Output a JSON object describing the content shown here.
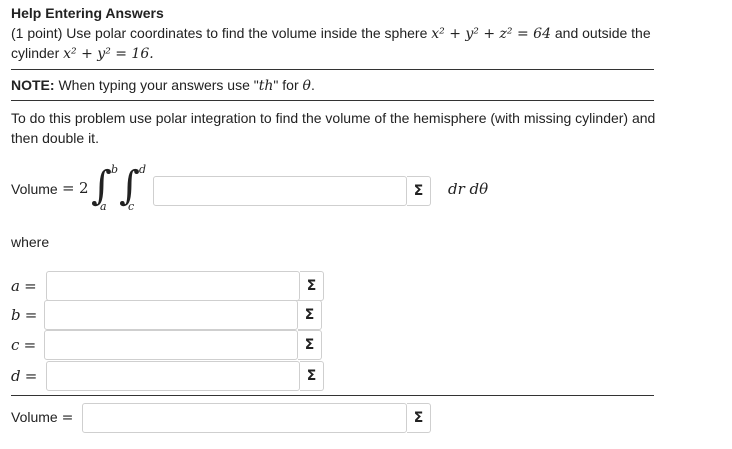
{
  "help_link": "Help Entering Answers",
  "problem": {
    "line1_text": "(1 point) Use polar coordinates to find the volume inside the sphere",
    "sphere_eq": "x² + y² + z² = 64",
    "line1_end": "and outside the",
    "line2_text": "cylinder",
    "cylinder_eq": "x² + y² = 16."
  },
  "note": {
    "label": "NOTE:",
    "text": "When typing your answers use \"",
    "th": "th",
    "mid": "\" for",
    "theta": "θ",
    "end": "."
  },
  "instructions": {
    "line1": "To do this problem use polar integration to find the volume of the hemisphere (with missing cylinder) and",
    "line2": "then double it."
  },
  "integral": {
    "volume_label": "Volume",
    "equals": "=",
    "coefficient": "2",
    "outer_lower": "a",
    "outer_upper": "b",
    "inner_lower": "c",
    "inner_upper": "d",
    "differentials": "dr dθ",
    "integrand_value": ""
  },
  "where_label": "where",
  "limits": [
    {
      "var": "a",
      "equals": "=",
      "value": ""
    },
    {
      "var": "b",
      "equals": "=",
      "value": ""
    },
    {
      "var": "c",
      "equals": "=",
      "value": ""
    },
    {
      "var": "d",
      "equals": "=",
      "value": ""
    }
  ],
  "final": {
    "label": "Volume",
    "equals": "=",
    "value": ""
  },
  "sigma_icon": "Σ"
}
